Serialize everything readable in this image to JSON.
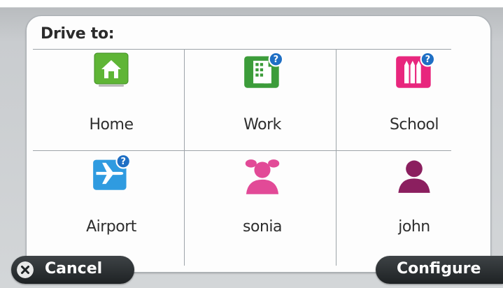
{
  "header": {
    "title": "Drive to:"
  },
  "destinations": [
    {
      "label": "Home",
      "icon": "home-icon",
      "color": "#5fb536",
      "has_question": false
    },
    {
      "label": "Work",
      "icon": "work-building-icon",
      "color": "#3c9c3a",
      "has_question": true
    },
    {
      "label": "School",
      "icon": "school-pencils-icon",
      "color": "#e8267d",
      "has_question": true
    },
    {
      "label": "Airport",
      "icon": "airport-plane-icon",
      "color": "#2f9be0",
      "has_question": true
    },
    {
      "label": "sonia",
      "icon": "female-contact-icon",
      "color": "#e24a97",
      "has_question": false
    },
    {
      "label": "john",
      "icon": "male-contact-icon",
      "color": "#8b1f5f",
      "has_question": false
    }
  ],
  "footer": {
    "cancel_label": "Cancel",
    "configure_label": "Configure"
  },
  "colors": {
    "question_badge": "#1f6fc4",
    "button_dark": "#2a2e30",
    "divider": "#9ea4a9"
  }
}
